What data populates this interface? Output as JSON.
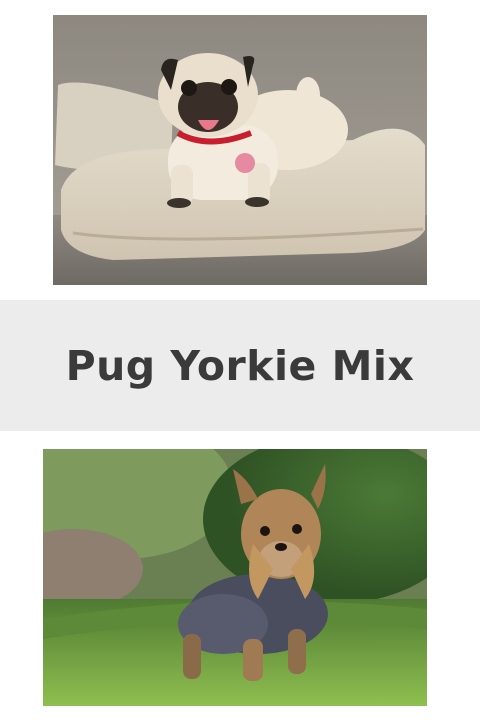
{
  "title": "Pug Yorkie Mix",
  "images": [
    {
      "name": "pug-photo",
      "subject": "pug-on-cushion"
    },
    {
      "name": "yorkie-photo",
      "subject": "yorkshire-terrier-on-grass"
    }
  ],
  "colors": {
    "banner_background": "#ececec",
    "title_text": "#3a3a3a",
    "page_background": "#ffffff"
  }
}
